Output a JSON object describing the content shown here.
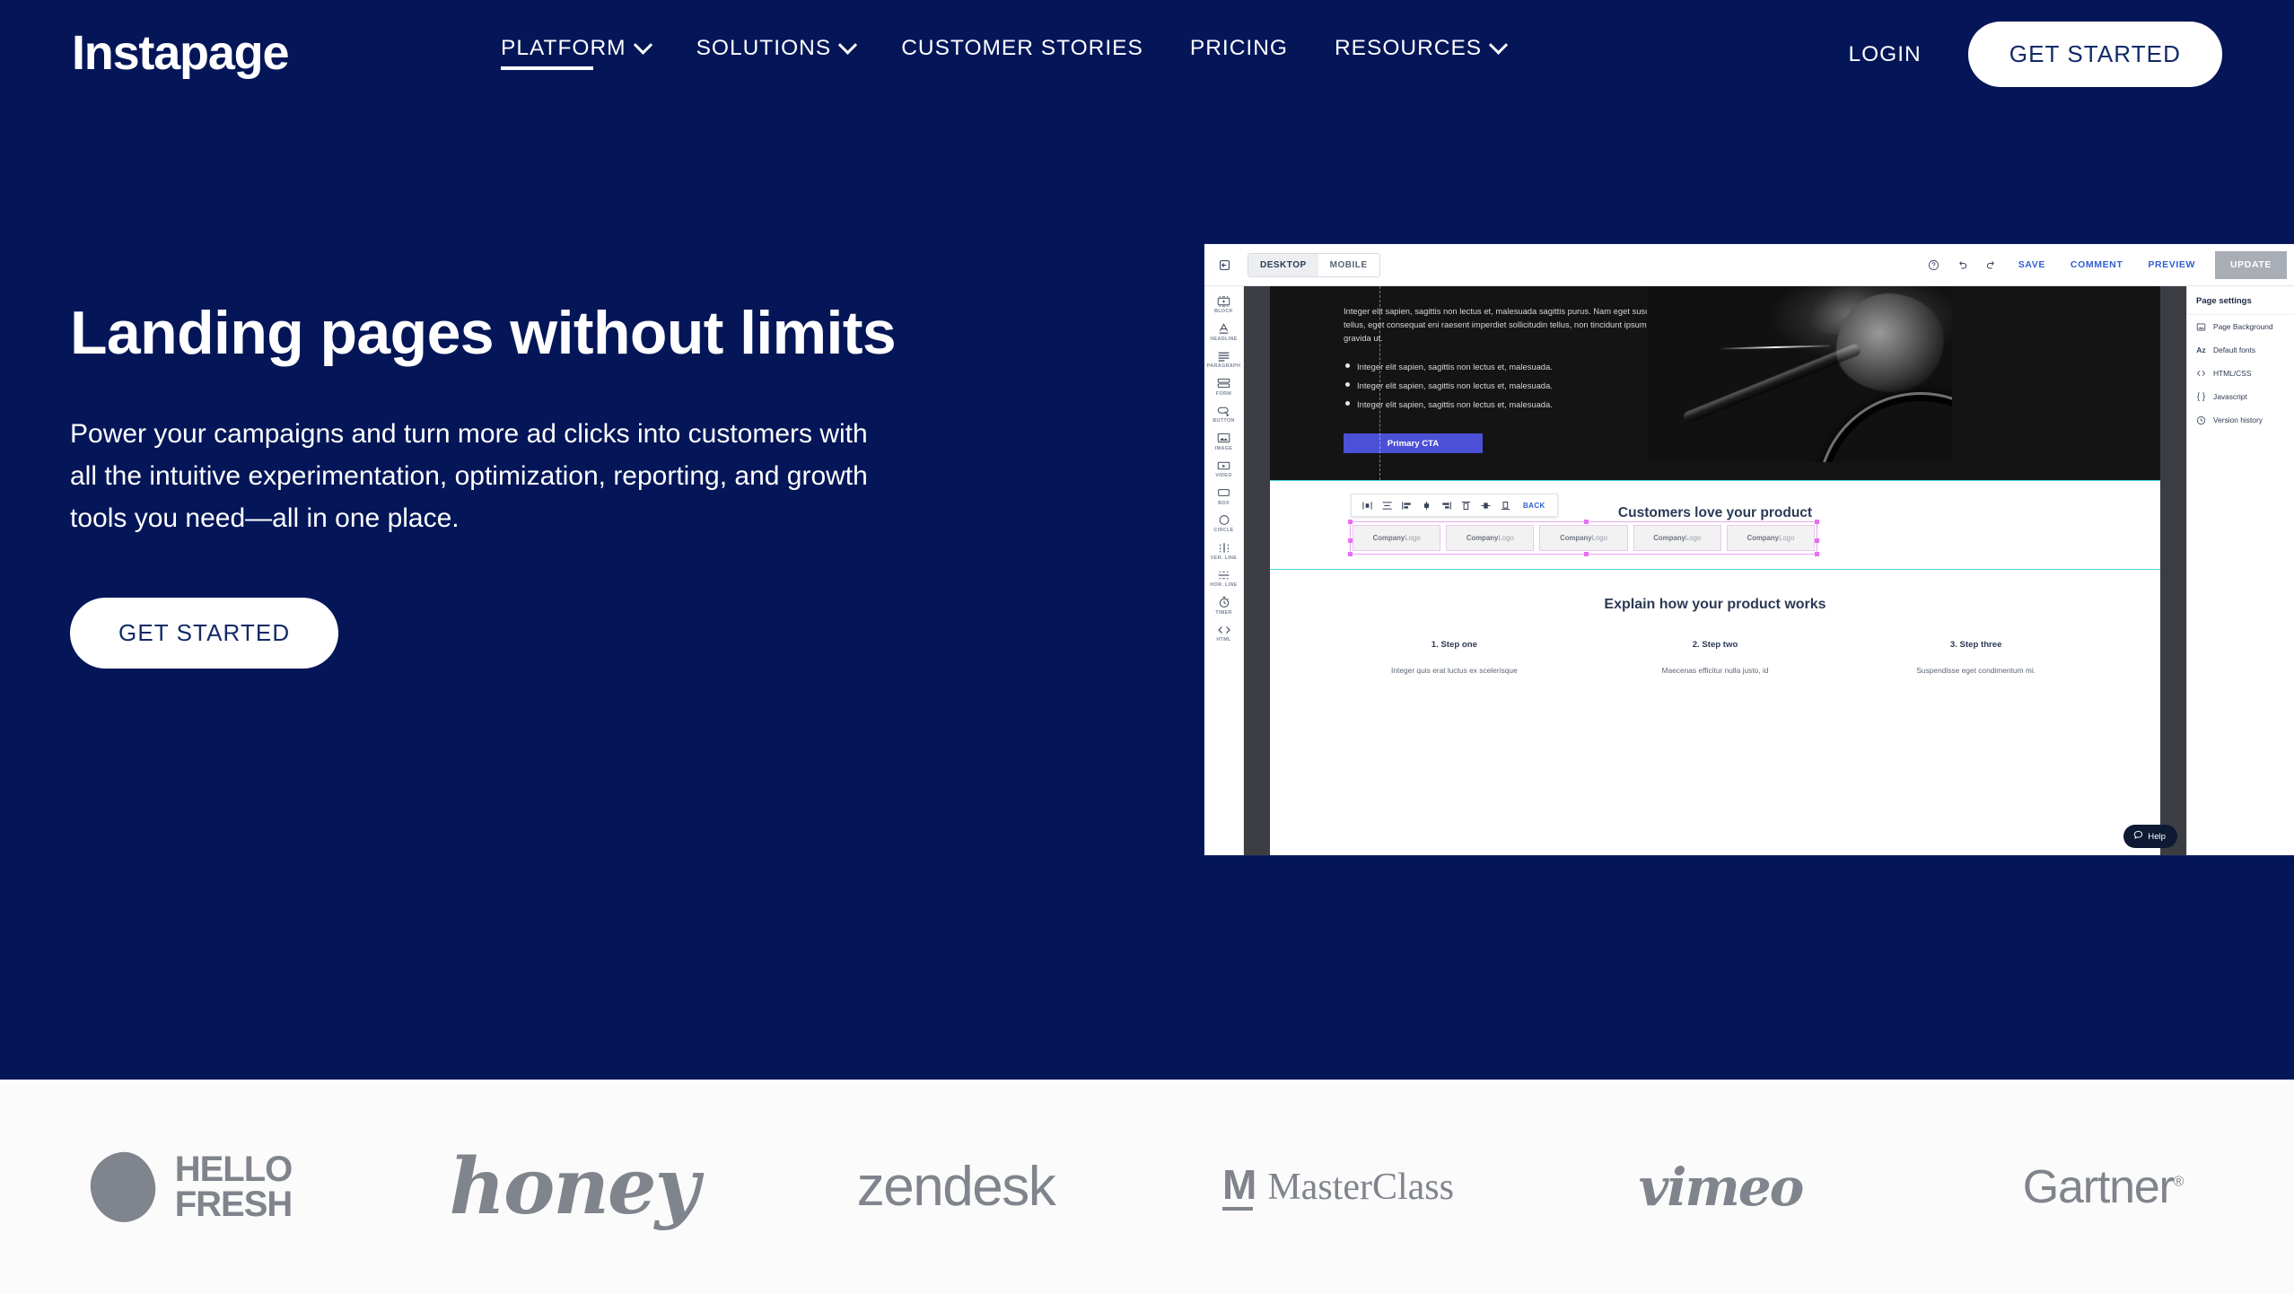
{
  "brand": {
    "logo_text": "Instapage",
    "navy": "#041658",
    "accent_white": "#ffffff"
  },
  "nav": {
    "items": [
      {
        "label": "PLATFORM",
        "has_caret": true,
        "active": true
      },
      {
        "label": "SOLUTIONS",
        "has_caret": true,
        "active": false
      },
      {
        "label": "CUSTOMER STORIES",
        "has_caret": false,
        "active": false
      },
      {
        "label": "PRICING",
        "has_caret": false,
        "active": false
      },
      {
        "label": "RESOURCES",
        "has_caret": true,
        "active": false
      }
    ],
    "login_label": "LOGIN",
    "cta_label": "GET STARTED"
  },
  "hero": {
    "title": "Landing pages without limits",
    "subtitle": "Power your campaigns and turn more ad clicks into customers with all the intuitive experimentation, optimization, reporting, and growth tools you need—all in one place.",
    "cta_label": "GET STARTED"
  },
  "editor": {
    "toolbar": {
      "collapse_icon": "collapse-panel-icon",
      "device_desktop": "DESKTOP",
      "device_mobile": "MOBILE",
      "active_device": "DESKTOP",
      "help_icon": "question-circle-icon",
      "undo_icon": "undo-arrow-icon",
      "redo_icon": "redo-arrow-icon",
      "save_label": "SAVE",
      "comment_label": "COMMENT",
      "preview_label": "PREVIEW",
      "update_label": "UPDATE"
    },
    "rail": [
      {
        "label": "BLOCK",
        "icon": "block-icon"
      },
      {
        "label": "HEADLINE",
        "icon": "headline-a-icon"
      },
      {
        "label": "PARAGRAPH",
        "icon": "paragraph-lines-icon"
      },
      {
        "label": "FORM",
        "icon": "form-icon"
      },
      {
        "label": "BUTTON",
        "icon": "button-cursor-icon"
      },
      {
        "label": "IMAGE",
        "icon": "image-icon"
      },
      {
        "label": "VIDEO",
        "icon": "video-play-icon"
      },
      {
        "label": "BOX",
        "icon": "box-rectangle-icon"
      },
      {
        "label": "CIRCLE",
        "icon": "circle-icon"
      },
      {
        "label": "VER. LINE",
        "icon": "vertical-line-icon"
      },
      {
        "label": "HOR. LINE",
        "icon": "horizontal-line-icon"
      },
      {
        "label": "TIMER",
        "icon": "timer-clock-icon"
      },
      {
        "label": "HTML",
        "icon": "code-brackets-icon"
      }
    ],
    "panel": {
      "title": "Page settings",
      "items": [
        {
          "label": "Page Background",
          "icon": "image-frame-icon"
        },
        {
          "label": "Default fonts",
          "icon": "az-font-icon"
        },
        {
          "label": "HTML/CSS",
          "icon": "angle-brackets-icon"
        },
        {
          "label": "Javascript",
          "icon": "curly-braces-icon"
        },
        {
          "label": "Version history",
          "icon": "clock-history-icon"
        }
      ]
    },
    "canvas": {
      "dark_paragraph": "Integer elit sapien, sagittis non lectus et, malesuada sagittis purus. Nam eget suscipit tellus, eget consequat eni raesent imperdiet sollicitudin tellus, non tincidunt ipsum gravida ut.",
      "bullets": [
        "Integer elit sapien, sagittis non lectus et, malesuada.",
        "Integer elit sapien, sagittis non lectus et, malesuada.",
        "Integer elit sapien, sagittis non lectus et, malesuada."
      ],
      "cta_label": "Primary CTA",
      "photo_alt": "cyclist-hand-on-handlebar-photo",
      "align_bar": {
        "icons": [
          "align-horizontal-center-icon",
          "align-vertical-center-icon",
          "align-left-icon",
          "align-center-icon",
          "align-right-icon",
          "align-top-icon",
          "align-middle-icon",
          "align-bottom-icon"
        ],
        "back_label": "BACK"
      },
      "section_heading": "Customers love your product",
      "logos": [
        {
          "bold": "Company",
          "light": "Logo"
        },
        {
          "bold": "Company",
          "light": "Logo"
        },
        {
          "bold": "Company",
          "light": "Logo"
        },
        {
          "bold": "Company",
          "light": "Logo"
        },
        {
          "bold": "Company",
          "light": "Logo"
        }
      ],
      "lower_heading": "Explain how your product works",
      "steps": [
        {
          "title": "1. Step one",
          "desc": "Integer quis erat luctus ex scelerisque"
        },
        {
          "title": "2. Step two",
          "desc": "Maecenas efficitur nulla justo, id"
        },
        {
          "title": "3. Step three",
          "desc": "Suspendisse eget condimentum mi."
        }
      ],
      "help_label": "Help",
      "help_icon": "chat-bubble-icon"
    }
  },
  "logo_strip": [
    {
      "name": "hellofresh",
      "line1": "HELLO",
      "line2": "FRESH"
    },
    {
      "name": "honey",
      "text": "honey"
    },
    {
      "name": "zendesk",
      "text": "zendesk"
    },
    {
      "name": "masterclass",
      "mark": "M",
      "text": "MasterClass"
    },
    {
      "name": "vimeo",
      "text": "vimeo"
    },
    {
      "name": "gartner",
      "text": "Gartner",
      "reg": "®"
    }
  ]
}
